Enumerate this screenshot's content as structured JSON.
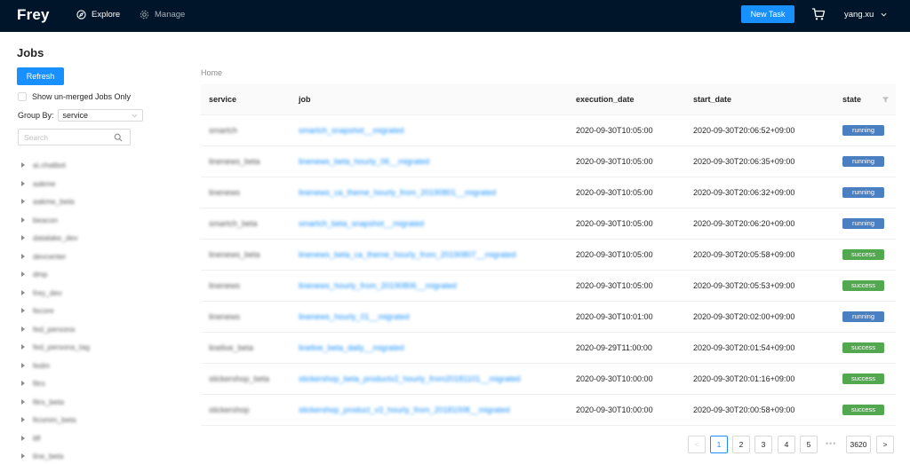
{
  "header": {
    "brand": "Frey",
    "nav": [
      {
        "label": "Explore",
        "icon": "compass-icon"
      },
      {
        "label": "Manage",
        "icon": "gear-icon"
      }
    ],
    "new_task_label": "New Task",
    "user_name": "yang.xu"
  },
  "sidebar": {
    "title": "Jobs",
    "refresh_label": "Refresh",
    "checkbox_label": "Show un-merged Jobs Only",
    "group_by_label": "Group By:",
    "group_by_value": "service",
    "search_placeholder": "Search",
    "tree_items": [
      "ai.chatbot",
      "aakme",
      "aakme_beta",
      "beacon",
      "datalake_dev",
      "devcenter",
      "dmp",
      "frey_dev",
      "fecore",
      "fed_persona",
      "fed_persona_tag",
      "fedm",
      "fitrs",
      "fitrs_beta",
      "ficomm_beta",
      "liff",
      "line_beta"
    ]
  },
  "main": {
    "breadcrumb": "Home",
    "columns": {
      "service": "service",
      "job": "job",
      "execution_date": "execution_date",
      "start_date": "start_date",
      "state": "state"
    },
    "rows": [
      {
        "service": "smartch",
        "job": "smartch_snapshot__migrated",
        "execution_date": "2020-09-30T10:05:00",
        "start_date": "2020-09-30T20:06:52+09:00",
        "state": "running"
      },
      {
        "service": "linenews_beta",
        "job": "linenews_beta_hourly_06__migrated",
        "execution_date": "2020-09-30T10:05:00",
        "start_date": "2020-09-30T20:06:35+09:00",
        "state": "running"
      },
      {
        "service": "linenews",
        "job": "linenews_ca_theme_hourly_from_20190801__migrated",
        "execution_date": "2020-09-30T10:05:00",
        "start_date": "2020-09-30T20:06:32+09:00",
        "state": "running"
      },
      {
        "service": "smartch_beta",
        "job": "smartch_beta_snapshot__migrated",
        "execution_date": "2020-09-30T10:05:00",
        "start_date": "2020-09-30T20:06:20+09:00",
        "state": "running"
      },
      {
        "service": "linenews_beta",
        "job": "linenews_beta_ca_theme_hourly_from_20190807__migrated",
        "execution_date": "2020-09-30T10:05:00",
        "start_date": "2020-09-30T20:05:58+09:00",
        "state": "success"
      },
      {
        "service": "linenews",
        "job": "linenews_hourly_from_20190806__migrated",
        "execution_date": "2020-09-30T10:05:00",
        "start_date": "2020-09-30T20:05:53+09:00",
        "state": "success"
      },
      {
        "service": "linenews",
        "job": "linenews_hourly_01__migrated",
        "execution_date": "2020-09-30T10:01:00",
        "start_date": "2020-09-30T20:02:00+09:00",
        "state": "running"
      },
      {
        "service": "linelive_beta",
        "job": "linelive_beta_daily__migrated",
        "execution_date": "2020-09-29T11:00:00",
        "start_date": "2020-09-30T20:01:54+09:00",
        "state": "success"
      },
      {
        "service": "stickershop_beta",
        "job": "stickershop_beta_productv2_hourly_from20181101__migrated",
        "execution_date": "2020-09-30T10:00:00",
        "start_date": "2020-09-30T20:01:16+09:00",
        "state": "success"
      },
      {
        "service": "stickershop",
        "job": "stickershop_product_v3_hourly_from_20181008__migrated",
        "execution_date": "2020-09-30T10:00:00",
        "start_date": "2020-09-30T20:00:58+09:00",
        "state": "success"
      }
    ]
  },
  "pagination": {
    "prev": "<",
    "next": ">",
    "pages": [
      "1",
      "2",
      "3",
      "4",
      "5"
    ],
    "ellipsis": "•••",
    "last": "3620",
    "current": "1"
  },
  "colors": {
    "nav_bg": "#001529",
    "primary": "#1890ff",
    "running": "#4a7fc1",
    "success": "#52a84f"
  }
}
